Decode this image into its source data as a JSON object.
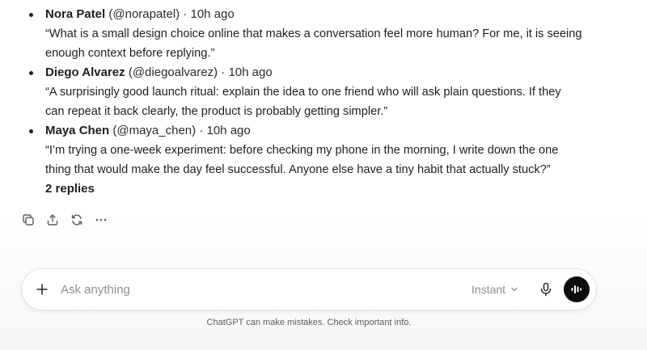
{
  "posts": [
    {
      "author": "Nora Patel",
      "handle": "(@norapatel)",
      "separator": "·",
      "time": "10h ago",
      "lines": [
        "“What is a small design choice online that makes a conversation feel more human? For me, it is seeing",
        "enough context before replying.”"
      ]
    },
    {
      "author": "Diego Alvarez",
      "handle": "(@diegoalvarez)",
      "separator": "·",
      "time": "10h ago",
      "lines": [
        "“A surprisingly good launch ritual: explain the idea to one friend who will ask plain questions. If they",
        "can repeat it back clearly, the product is probably getting simpler.”"
      ]
    },
    {
      "author": "Maya Chen",
      "handle": "(@maya_chen)",
      "separator": "·",
      "time": "10h ago",
      "lines": [
        "“I’m trying a one-week experiment: before checking my phone in the morning, I write down the one",
        "thing that would make the day feel successful. Anyone else have a tiny habit that actually stuck?”"
      ],
      "replies": "2 replies"
    }
  ],
  "actions": [
    "copy-icon",
    "share-icon",
    "regenerate-icon",
    "more-icon"
  ],
  "composer": {
    "placeholder": "Ask anything",
    "model": "Instant",
    "icons": [
      "plus-icon",
      "chevron-down-icon",
      "microphone-icon",
      "voice-mode-icon"
    ]
  },
  "disclaimer": "ChatGPT can make mistakes. Check important info.",
  "colors": {
    "text": "#1f1f1f",
    "muted": "#8e8e8e",
    "voice_button": "#0d0d0d"
  }
}
